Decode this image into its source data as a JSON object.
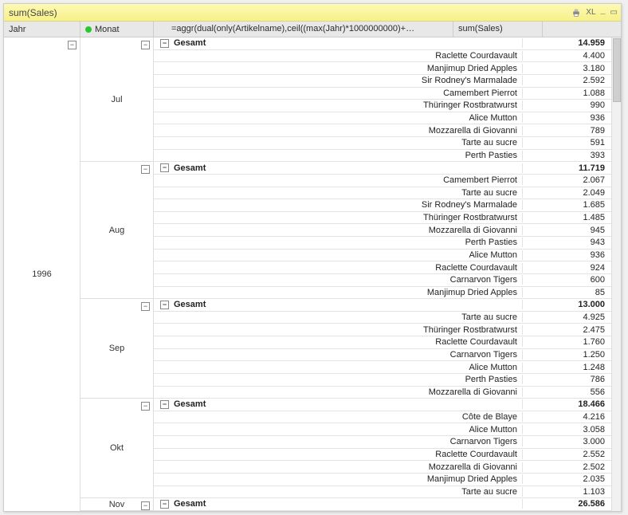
{
  "title": "sum(Sales)",
  "title_icons": {
    "xl": "XL"
  },
  "columns": {
    "jahr": "Jahr",
    "monat": "Monat",
    "expr": "=aggr(dual(only(Artikelname),ceil((max(Jahr)*1000000000)+…",
    "sum": "sum(Sales)"
  },
  "jahr": "1996",
  "total_label": "Gesamt",
  "months": [
    {
      "label": "Jul",
      "total": "14.959",
      "rows": [
        {
          "name": "Raclette Courdavault",
          "val": "4.400"
        },
        {
          "name": "Manjimup Dried Apples",
          "val": "3.180"
        },
        {
          "name": "Sir Rodney's Marmalade",
          "val": "2.592"
        },
        {
          "name": "Camembert Pierrot",
          "val": "1.088"
        },
        {
          "name": "Thüringer Rostbratwurst",
          "val": "990"
        },
        {
          "name": "Alice Mutton",
          "val": "936"
        },
        {
          "name": "Mozzarella di Giovanni",
          "val": "789"
        },
        {
          "name": "Tarte au sucre",
          "val": "591"
        },
        {
          "name": "Perth Pasties",
          "val": "393"
        }
      ]
    },
    {
      "label": "Aug",
      "total": "11.719",
      "rows": [
        {
          "name": "Camembert Pierrot",
          "val": "2.067"
        },
        {
          "name": "Tarte au sucre",
          "val": "2.049"
        },
        {
          "name": "Sir Rodney's Marmalade",
          "val": "1.685"
        },
        {
          "name": "Thüringer Rostbratwurst",
          "val": "1.485"
        },
        {
          "name": "Mozzarella di Giovanni",
          "val": "945"
        },
        {
          "name": "Perth Pasties",
          "val": "943"
        },
        {
          "name": "Alice Mutton",
          "val": "936"
        },
        {
          "name": "Raclette Courdavault",
          "val": "924"
        },
        {
          "name": "Carnarvon Tigers",
          "val": "600"
        },
        {
          "name": "Manjimup Dried Apples",
          "val": "85"
        }
      ]
    },
    {
      "label": "Sep",
      "total": "13.000",
      "rows": [
        {
          "name": "Tarte au sucre",
          "val": "4.925"
        },
        {
          "name": "Thüringer Rostbratwurst",
          "val": "2.475"
        },
        {
          "name": "Raclette Courdavault",
          "val": "1.760"
        },
        {
          "name": "Carnarvon Tigers",
          "val": "1.250"
        },
        {
          "name": "Alice Mutton",
          "val": "1.248"
        },
        {
          "name": "Perth Pasties",
          "val": "786"
        },
        {
          "name": "Mozzarella di Giovanni",
          "val": "556"
        }
      ]
    },
    {
      "label": "Okt",
      "total": "18.466",
      "rows": [
        {
          "name": "Côte de Blaye",
          "val": "4.216"
        },
        {
          "name": "Alice Mutton",
          "val": "3.058"
        },
        {
          "name": "Carnarvon Tigers",
          "val": "3.000"
        },
        {
          "name": "Raclette Courdavault",
          "val": "2.552"
        },
        {
          "name": "Mozzarella di Giovanni",
          "val": "2.502"
        },
        {
          "name": "Manjimup Dried Apples",
          "val": "2.035"
        },
        {
          "name": "Tarte au sucre",
          "val": "1.103"
        }
      ]
    },
    {
      "label": "Nov",
      "total": "26.586",
      "rows": []
    }
  ]
}
